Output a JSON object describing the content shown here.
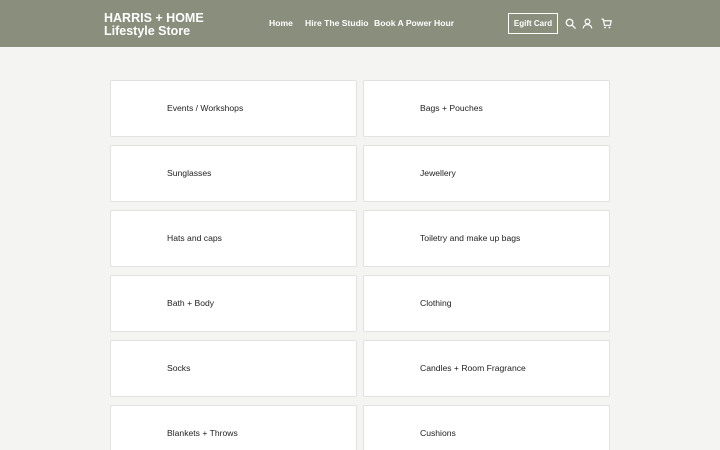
{
  "brand": {
    "line1": "HARRIS + HOME",
    "line2": "Lifestyle Store"
  },
  "nav": {
    "items": [
      "Home",
      "Hire The Studio",
      "Book A Power Hour"
    ]
  },
  "header_actions": {
    "egift_label": "Egift Card",
    "icons": [
      "search-icon",
      "account-icon",
      "cart-icon"
    ]
  },
  "colors": {
    "header_bg": "#898e7d",
    "page_bg": "#f4f4f3",
    "card_bg": "#ffffff"
  },
  "categories": [
    "Events / Workshops",
    "Bags + Pouches",
    "Sunglasses",
    "Jewellery",
    "Hats and caps",
    "Toiletry and make up bags",
    "Bath + Body",
    "Clothing",
    "Socks",
    "Candles + Room Fragrance",
    "Blankets + Throws",
    "Cushions"
  ]
}
